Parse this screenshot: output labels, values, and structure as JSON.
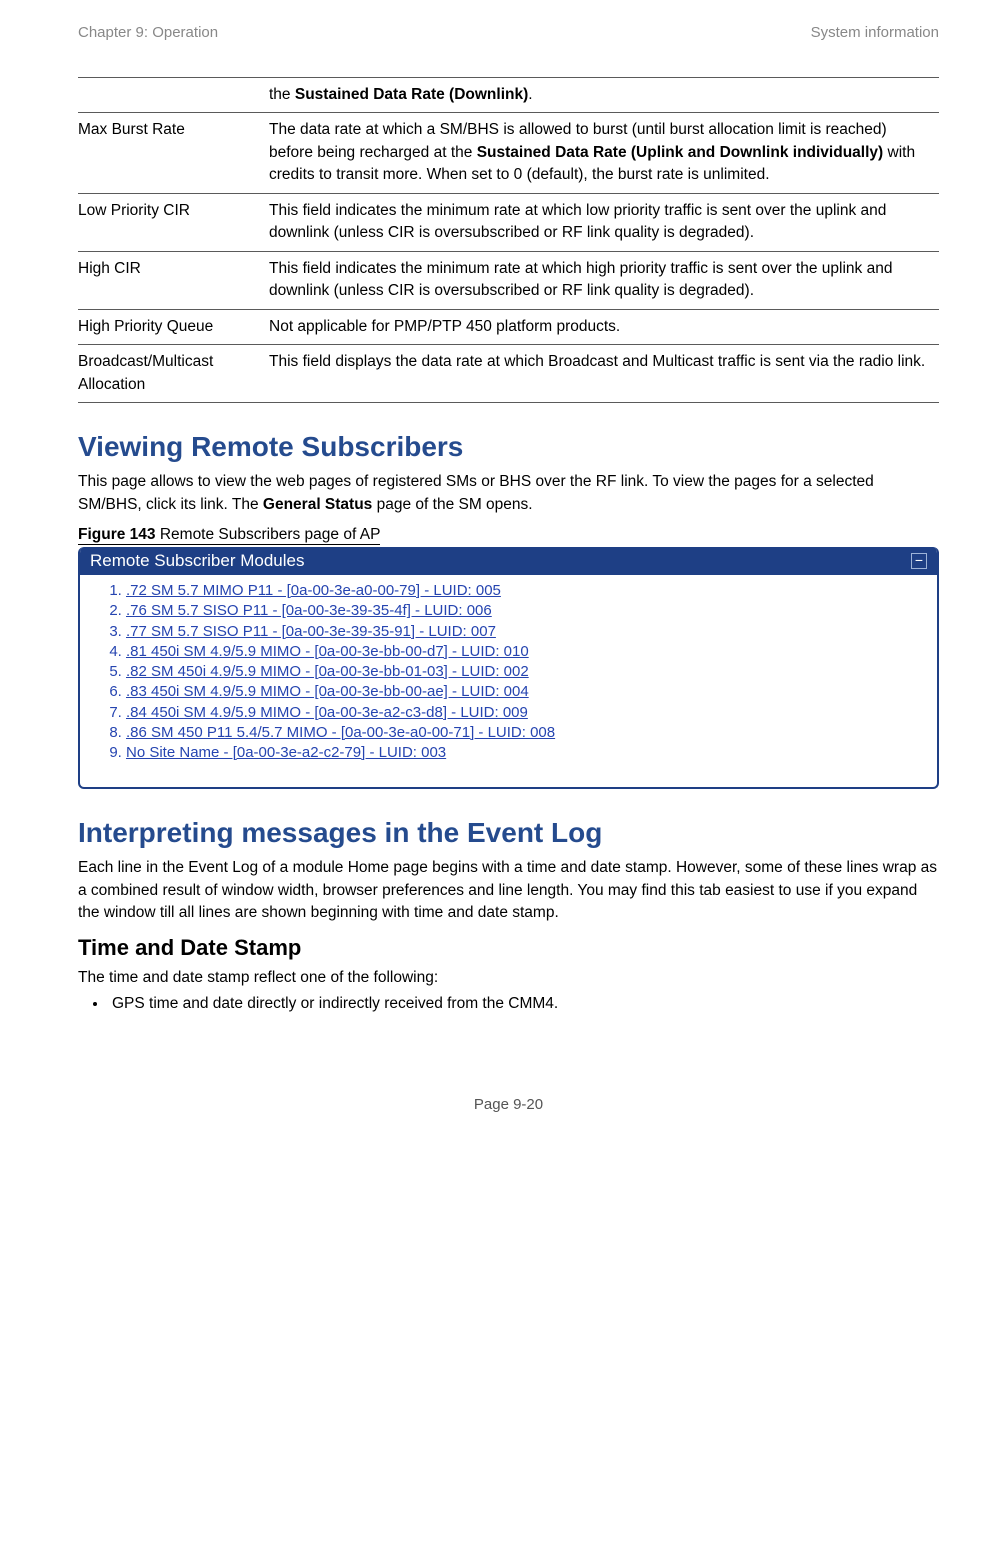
{
  "header": {
    "left": "Chapter 9:  Operation",
    "right": "System information"
  },
  "table_rows": [
    {
      "term": "",
      "desc_pre": "the ",
      "desc_bold": "Sustained Data Rate (Downlink)",
      "desc_post": "."
    },
    {
      "term": "Max Burst Rate",
      "desc_pre": "The data rate at which a SM/BHS is allowed to burst (until burst allocation limit is reached) before being recharged at the ",
      "desc_bold": "Sustained Data Rate (Uplink and Downlink individually)",
      "desc_post": " with credits to transit more. When set to 0 (default), the burst rate is unlimited."
    },
    {
      "term": "Low Priority CIR",
      "desc_pre": "This field indicates the minimum rate at which low priority traffic is sent over the uplink and downlink (unless CIR is oversubscribed or RF link quality is degraded).",
      "desc_bold": "",
      "desc_post": ""
    },
    {
      "term": "High CIR",
      "desc_pre": "This field indicates the minimum rate at which high priority traffic is sent over the uplink and downlink (unless CIR is oversubscribed or RF link quality is degraded).",
      "desc_bold": "",
      "desc_post": ""
    },
    {
      "term": "High Priority Queue",
      "desc_pre": "Not applicable for PMP/PTP 450 platform products.",
      "desc_bold": "",
      "desc_post": ""
    },
    {
      "term": "Broadcast/Multicast Allocation",
      "desc_pre": "This field displays the data rate at which Broadcast and Multicast traffic is sent via the radio link.",
      "desc_bold": "",
      "desc_post": ""
    }
  ],
  "section1": {
    "title": "Viewing Remote Subscribers",
    "para_pre": "This page allows to view the web pages of registered SMs or BHS over the RF link. To view the pages for a selected SM/BHS, click its link. The ",
    "para_bold": "General Status",
    "para_post": " page of the SM opens.",
    "fig_label_b": "Figure 143",
    "fig_label_rest": " Remote Subscribers page of AP"
  },
  "panel": {
    "title": "Remote Subscriber Modules",
    "items": [
      ".72 SM 5.7 MIMO P11 - [0a-00-3e-a0-00-79] - LUID: 005",
      ".76 SM 5.7 SISO P11 - [0a-00-3e-39-35-4f] - LUID: 006",
      ".77 SM 5.7 SISO P11 - [0a-00-3e-39-35-91] - LUID: 007",
      ".81 450i SM 4.9/5.9 MIMO - [0a-00-3e-bb-00-d7] - LUID: 010",
      ".82 SM 450i 4.9/5.9 MIMO - [0a-00-3e-bb-01-03] - LUID: 002",
      ".83 450i SM 4.9/5.9 MIMO - [0a-00-3e-bb-00-ae] - LUID: 004",
      ".84 450i SM 4.9/5.9 MIMO - [0a-00-3e-a2-c3-d8] - LUID: 009",
      ".86 SM 450 P11 5.4/5.7 MIMO - [0a-00-3e-a0-00-71] - LUID: 008",
      "No Site Name - [0a-00-3e-a2-c2-79] - LUID: 003"
    ]
  },
  "section2": {
    "title": "Interpreting messages in the Event Log",
    "para": "Each line in the Event Log of a module Home page begins with a time and date stamp. However, some of these lines wrap as a combined result of window width, browser preferences and line length. You may find this tab easiest to use if you expand the window till all lines are shown beginning with time and date stamp.",
    "sub_title": "Time and Date Stamp",
    "sub_para": "The time and date stamp reflect one of the following:",
    "bullet1": "GPS time and date directly or indirectly received from the CMM4."
  },
  "footer": "Page 9-20"
}
